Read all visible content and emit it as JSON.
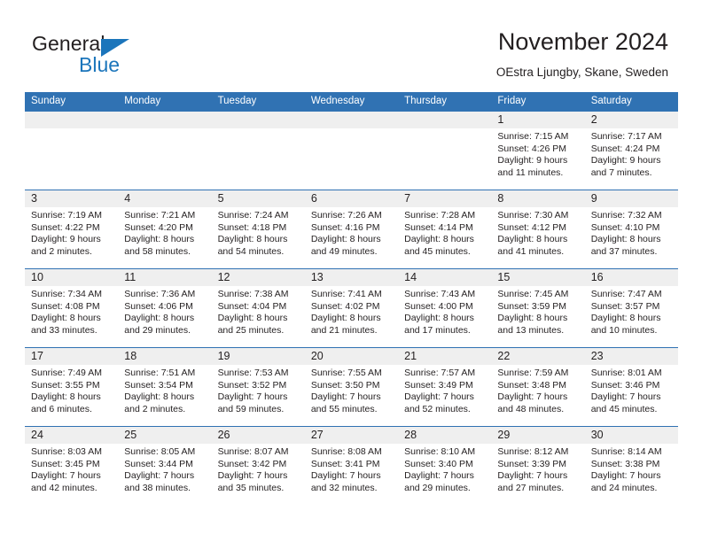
{
  "brand": {
    "word_one": "General",
    "word_two": "Blue",
    "flag_icon": "triangle-flag-icon",
    "accent_color": "#1b75bb"
  },
  "header": {
    "title": "November 2024",
    "subtitle": "OEstra Ljungby, Skane, Sweden"
  },
  "theme": {
    "header_row_bg": "#3072b3",
    "day_band_bg": "#efefef",
    "cell_border": "#3072b3",
    "text_color": "#231f20"
  },
  "labels": {
    "sunrise_prefix": "Sunrise:",
    "sunset_prefix": "Sunset:",
    "daylight_prefix": "Daylight:"
  },
  "weekdays": [
    "Sunday",
    "Monday",
    "Tuesday",
    "Wednesday",
    "Thursday",
    "Friday",
    "Saturday"
  ],
  "weeks": [
    [
      {
        "day": "",
        "empty": true
      },
      {
        "day": "",
        "empty": true
      },
      {
        "day": "",
        "empty": true
      },
      {
        "day": "",
        "empty": true
      },
      {
        "day": "",
        "empty": true
      },
      {
        "day": "1",
        "sunrise": "Sunrise: 7:15 AM",
        "sunset": "Sunset: 4:26 PM",
        "daylight_1": "Daylight: 9 hours",
        "daylight_2": "and 11 minutes."
      },
      {
        "day": "2",
        "sunrise": "Sunrise: 7:17 AM",
        "sunset": "Sunset: 4:24 PM",
        "daylight_1": "Daylight: 9 hours",
        "daylight_2": "and 7 minutes."
      }
    ],
    [
      {
        "day": "3",
        "sunrise": "Sunrise: 7:19 AM",
        "sunset": "Sunset: 4:22 PM",
        "daylight_1": "Daylight: 9 hours",
        "daylight_2": "and 2 minutes."
      },
      {
        "day": "4",
        "sunrise": "Sunrise: 7:21 AM",
        "sunset": "Sunset: 4:20 PM",
        "daylight_1": "Daylight: 8 hours",
        "daylight_2": "and 58 minutes."
      },
      {
        "day": "5",
        "sunrise": "Sunrise: 7:24 AM",
        "sunset": "Sunset: 4:18 PM",
        "daylight_1": "Daylight: 8 hours",
        "daylight_2": "and 54 minutes."
      },
      {
        "day": "6",
        "sunrise": "Sunrise: 7:26 AM",
        "sunset": "Sunset: 4:16 PM",
        "daylight_1": "Daylight: 8 hours",
        "daylight_2": "and 49 minutes."
      },
      {
        "day": "7",
        "sunrise": "Sunrise: 7:28 AM",
        "sunset": "Sunset: 4:14 PM",
        "daylight_1": "Daylight: 8 hours",
        "daylight_2": "and 45 minutes."
      },
      {
        "day": "8",
        "sunrise": "Sunrise: 7:30 AM",
        "sunset": "Sunset: 4:12 PM",
        "daylight_1": "Daylight: 8 hours",
        "daylight_2": "and 41 minutes."
      },
      {
        "day": "9",
        "sunrise": "Sunrise: 7:32 AM",
        "sunset": "Sunset: 4:10 PM",
        "daylight_1": "Daylight: 8 hours",
        "daylight_2": "and 37 minutes."
      }
    ],
    [
      {
        "day": "10",
        "sunrise": "Sunrise: 7:34 AM",
        "sunset": "Sunset: 4:08 PM",
        "daylight_1": "Daylight: 8 hours",
        "daylight_2": "and 33 minutes."
      },
      {
        "day": "11",
        "sunrise": "Sunrise: 7:36 AM",
        "sunset": "Sunset: 4:06 PM",
        "daylight_1": "Daylight: 8 hours",
        "daylight_2": "and 29 minutes."
      },
      {
        "day": "12",
        "sunrise": "Sunrise: 7:38 AM",
        "sunset": "Sunset: 4:04 PM",
        "daylight_1": "Daylight: 8 hours",
        "daylight_2": "and 25 minutes."
      },
      {
        "day": "13",
        "sunrise": "Sunrise: 7:41 AM",
        "sunset": "Sunset: 4:02 PM",
        "daylight_1": "Daylight: 8 hours",
        "daylight_2": "and 21 minutes."
      },
      {
        "day": "14",
        "sunrise": "Sunrise: 7:43 AM",
        "sunset": "Sunset: 4:00 PM",
        "daylight_1": "Daylight: 8 hours",
        "daylight_2": "and 17 minutes."
      },
      {
        "day": "15",
        "sunrise": "Sunrise: 7:45 AM",
        "sunset": "Sunset: 3:59 PM",
        "daylight_1": "Daylight: 8 hours",
        "daylight_2": "and 13 minutes."
      },
      {
        "day": "16",
        "sunrise": "Sunrise: 7:47 AM",
        "sunset": "Sunset: 3:57 PM",
        "daylight_1": "Daylight: 8 hours",
        "daylight_2": "and 10 minutes."
      }
    ],
    [
      {
        "day": "17",
        "sunrise": "Sunrise: 7:49 AM",
        "sunset": "Sunset: 3:55 PM",
        "daylight_1": "Daylight: 8 hours",
        "daylight_2": "and 6 minutes."
      },
      {
        "day": "18",
        "sunrise": "Sunrise: 7:51 AM",
        "sunset": "Sunset: 3:54 PM",
        "daylight_1": "Daylight: 8 hours",
        "daylight_2": "and 2 minutes."
      },
      {
        "day": "19",
        "sunrise": "Sunrise: 7:53 AM",
        "sunset": "Sunset: 3:52 PM",
        "daylight_1": "Daylight: 7 hours",
        "daylight_2": "and 59 minutes."
      },
      {
        "day": "20",
        "sunrise": "Sunrise: 7:55 AM",
        "sunset": "Sunset: 3:50 PM",
        "daylight_1": "Daylight: 7 hours",
        "daylight_2": "and 55 minutes."
      },
      {
        "day": "21",
        "sunrise": "Sunrise: 7:57 AM",
        "sunset": "Sunset: 3:49 PM",
        "daylight_1": "Daylight: 7 hours",
        "daylight_2": "and 52 minutes."
      },
      {
        "day": "22",
        "sunrise": "Sunrise: 7:59 AM",
        "sunset": "Sunset: 3:48 PM",
        "daylight_1": "Daylight: 7 hours",
        "daylight_2": "and 48 minutes."
      },
      {
        "day": "23",
        "sunrise": "Sunrise: 8:01 AM",
        "sunset": "Sunset: 3:46 PM",
        "daylight_1": "Daylight: 7 hours",
        "daylight_2": "and 45 minutes."
      }
    ],
    [
      {
        "day": "24",
        "sunrise": "Sunrise: 8:03 AM",
        "sunset": "Sunset: 3:45 PM",
        "daylight_1": "Daylight: 7 hours",
        "daylight_2": "and 42 minutes."
      },
      {
        "day": "25",
        "sunrise": "Sunrise: 8:05 AM",
        "sunset": "Sunset: 3:44 PM",
        "daylight_1": "Daylight: 7 hours",
        "daylight_2": "and 38 minutes."
      },
      {
        "day": "26",
        "sunrise": "Sunrise: 8:07 AM",
        "sunset": "Sunset: 3:42 PM",
        "daylight_1": "Daylight: 7 hours",
        "daylight_2": "and 35 minutes."
      },
      {
        "day": "27",
        "sunrise": "Sunrise: 8:08 AM",
        "sunset": "Sunset: 3:41 PM",
        "daylight_1": "Daylight: 7 hours",
        "daylight_2": "and 32 minutes."
      },
      {
        "day": "28",
        "sunrise": "Sunrise: 8:10 AM",
        "sunset": "Sunset: 3:40 PM",
        "daylight_1": "Daylight: 7 hours",
        "daylight_2": "and 29 minutes."
      },
      {
        "day": "29",
        "sunrise": "Sunrise: 8:12 AM",
        "sunset": "Sunset: 3:39 PM",
        "daylight_1": "Daylight: 7 hours",
        "daylight_2": "and 27 minutes."
      },
      {
        "day": "30",
        "sunrise": "Sunrise: 8:14 AM",
        "sunset": "Sunset: 3:38 PM",
        "daylight_1": "Daylight: 7 hours",
        "daylight_2": "and 24 minutes."
      }
    ]
  ]
}
